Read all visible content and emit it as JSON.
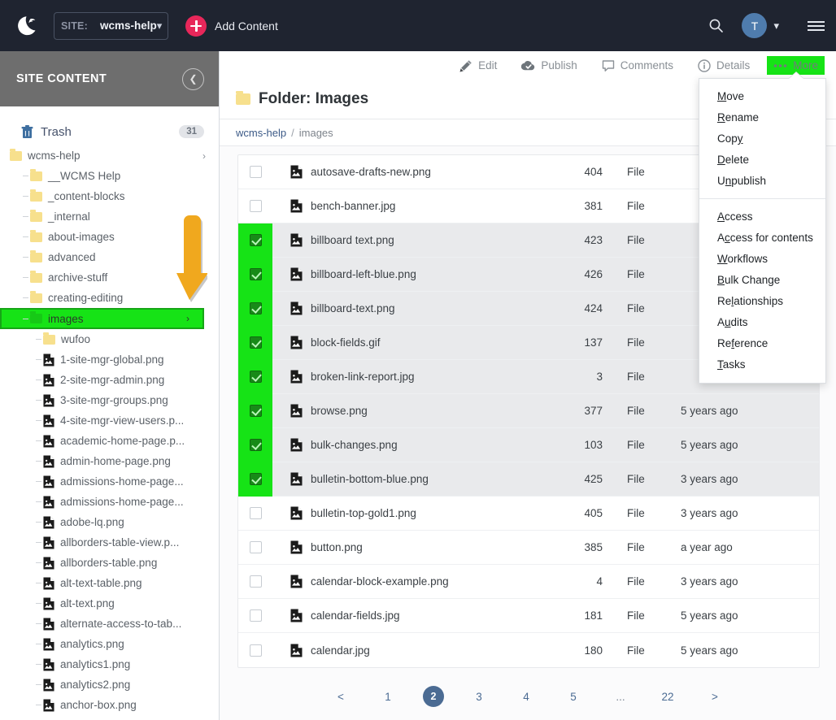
{
  "topbar": {
    "logo_icon": "crescent-logo-icon",
    "site_label": "SITE:",
    "site_value": "wcms-help",
    "add_content_label": "Add Content",
    "search_icon": "search-icon",
    "avatar_initial": "T",
    "menu_icon": "hamburger-icon"
  },
  "sidebar": {
    "header_title": "SITE CONTENT",
    "collapse_icon": "chevron-left-icon",
    "trash": {
      "label": "Trash",
      "count": "31",
      "icon": "trash-icon"
    },
    "tree": [
      {
        "label": "wcms-help",
        "type": "folder",
        "depth": 1,
        "chevron": "›",
        "selected": false
      },
      {
        "label": "__WCMS Help",
        "type": "folder",
        "depth": 2,
        "selected": false
      },
      {
        "label": "_content-blocks",
        "type": "folder",
        "depth": 2,
        "selected": false
      },
      {
        "label": "_internal",
        "type": "folder",
        "depth": 2,
        "selected": false
      },
      {
        "label": "about-images",
        "type": "folder",
        "depth": 2,
        "selected": false
      },
      {
        "label": "advanced",
        "type": "folder",
        "depth": 2,
        "selected": false
      },
      {
        "label": "archive-stuff",
        "type": "folder",
        "depth": 2,
        "selected": false
      },
      {
        "label": "creating-editing",
        "type": "folder",
        "depth": 2,
        "selected": false
      },
      {
        "label": "images",
        "type": "folder",
        "depth": 2,
        "chevron": "›",
        "selected": true
      },
      {
        "label": "wufoo",
        "type": "folder",
        "depth": 3,
        "selected": false
      },
      {
        "label": "1-site-mgr-global.png",
        "type": "file",
        "depth": 3,
        "selected": false
      },
      {
        "label": "2-site-mgr-admin.png",
        "type": "file",
        "depth": 3,
        "selected": false
      },
      {
        "label": "3-site-mgr-groups.png",
        "type": "file",
        "depth": 3,
        "selected": false
      },
      {
        "label": "4-site-mgr-view-users.p...",
        "type": "file",
        "depth": 3,
        "selected": false
      },
      {
        "label": "academic-home-page.p...",
        "type": "file",
        "depth": 3,
        "selected": false
      },
      {
        "label": "admin-home-page.png",
        "type": "file",
        "depth": 3,
        "selected": false
      },
      {
        "label": "admissions-home-page...",
        "type": "file",
        "depth": 3,
        "selected": false
      },
      {
        "label": "admissions-home-page...",
        "type": "file",
        "depth": 3,
        "selected": false
      },
      {
        "label": "adobe-lq.png",
        "type": "file",
        "depth": 3,
        "selected": false
      },
      {
        "label": "allborders-table-view.p...",
        "type": "file",
        "depth": 3,
        "selected": false
      },
      {
        "label": "allborders-table.png",
        "type": "file",
        "depth": 3,
        "selected": false
      },
      {
        "label": "alt-text-table.png",
        "type": "file",
        "depth": 3,
        "selected": false
      },
      {
        "label": "alt-text.png",
        "type": "file",
        "depth": 3,
        "selected": false
      },
      {
        "label": "alternate-access-to-tab...",
        "type": "file",
        "depth": 3,
        "selected": false
      },
      {
        "label": "analytics.png",
        "type": "file",
        "depth": 3,
        "selected": false
      },
      {
        "label": "analytics1.png",
        "type": "file",
        "depth": 3,
        "selected": false
      },
      {
        "label": "analytics2.png",
        "type": "file",
        "depth": 3,
        "selected": false
      },
      {
        "label": "anchor-box.png",
        "type": "file",
        "depth": 3,
        "selected": false
      }
    ]
  },
  "annotation": {
    "arrow_icon": "down-arrow-annotation",
    "arrow_color": "#f0a81e"
  },
  "toolbar": [
    {
      "label": "Edit",
      "icon": "pencil-icon",
      "highlighted": false
    },
    {
      "label": "Publish",
      "icon": "cloud-check-icon",
      "highlighted": false
    },
    {
      "label": "Comments",
      "icon": "comment-icon",
      "highlighted": false
    },
    {
      "label": "Details",
      "icon": "info-icon",
      "highlighted": false
    },
    {
      "label": "More",
      "icon": "ellipsis-icon",
      "highlighted": true
    }
  ],
  "page": {
    "title": "Folder: Images",
    "folder_icon": "folder-icon",
    "breadcrumb": {
      "root": "wcms-help",
      "separator": "/",
      "current": "images"
    }
  },
  "more_menu": {
    "group1": [
      {
        "label": "Move",
        "accel": "M"
      },
      {
        "label": "Rename",
        "accel": "R"
      },
      {
        "label": "Copy",
        "accel": "y"
      },
      {
        "label": "Delete",
        "accel": "D"
      },
      {
        "label": "Unpublish",
        "accel": "n"
      }
    ],
    "group2": [
      {
        "label": "Access",
        "accel": "A"
      },
      {
        "label": "Access for contents",
        "accel": "c"
      },
      {
        "label": "Workflows",
        "accel": "W"
      },
      {
        "label": "Bulk Change",
        "accel": "B"
      },
      {
        "label": "Relationships",
        "accel": "l"
      },
      {
        "label": "Audits",
        "accel": "u"
      },
      {
        "label": "Reference",
        "accel": "f"
      },
      {
        "label": "Tasks",
        "accel": "T"
      }
    ]
  },
  "table": {
    "rows": [
      {
        "name": "autosave-drafts-new.png",
        "num": "404",
        "type": "File",
        "date": "",
        "selected": false
      },
      {
        "name": "bench-banner.jpg",
        "num": "381",
        "type": "File",
        "date": "",
        "selected": false
      },
      {
        "name": "billboard text.png",
        "num": "423",
        "type": "File",
        "date": "",
        "selected": true
      },
      {
        "name": "billboard-left-blue.png",
        "num": "426",
        "type": "File",
        "date": "",
        "selected": true
      },
      {
        "name": "billboard-text.png",
        "num": "424",
        "type": "File",
        "date": "",
        "selected": true
      },
      {
        "name": "block-fields.gif",
        "num": "137",
        "type": "File",
        "date": "",
        "selected": true
      },
      {
        "name": "broken-link-report.jpg",
        "num": "3",
        "type": "File",
        "date": "",
        "selected": true
      },
      {
        "name": "browse.png",
        "num": "377",
        "type": "File",
        "date": "5 years ago",
        "selected": true
      },
      {
        "name": "bulk-changes.png",
        "num": "103",
        "type": "File",
        "date": "5 years ago",
        "selected": true
      },
      {
        "name": "bulletin-bottom-blue.png",
        "num": "425",
        "type": "File",
        "date": "3 years ago",
        "selected": true
      },
      {
        "name": "bulletin-top-gold1.png",
        "num": "405",
        "type": "File",
        "date": "3 years ago",
        "selected": false
      },
      {
        "name": "button.png",
        "num": "385",
        "type": "File",
        "date": "a year ago",
        "selected": false
      },
      {
        "name": "calendar-block-example.png",
        "num": "4",
        "type": "File",
        "date": "3 years ago",
        "selected": false
      },
      {
        "name": "calendar-fields.jpg",
        "num": "181",
        "type": "File",
        "date": "5 years ago",
        "selected": false
      },
      {
        "name": "calendar.jpg",
        "num": "180",
        "type": "File",
        "date": "5 years ago",
        "selected": false
      }
    ]
  },
  "pagination": {
    "prev": "<",
    "next": ">",
    "pages": [
      "1",
      "2",
      "3",
      "4",
      "5",
      "...",
      "22"
    ],
    "current": "2"
  },
  "colors": {
    "topbar_bg": "#1f2430",
    "accent_pink": "#e8275a",
    "highlight_green": "#16e316",
    "annotation_orange": "#f0a81e",
    "pagination_blue": "#4b6b93",
    "folder_yellow": "#f7e08d"
  }
}
